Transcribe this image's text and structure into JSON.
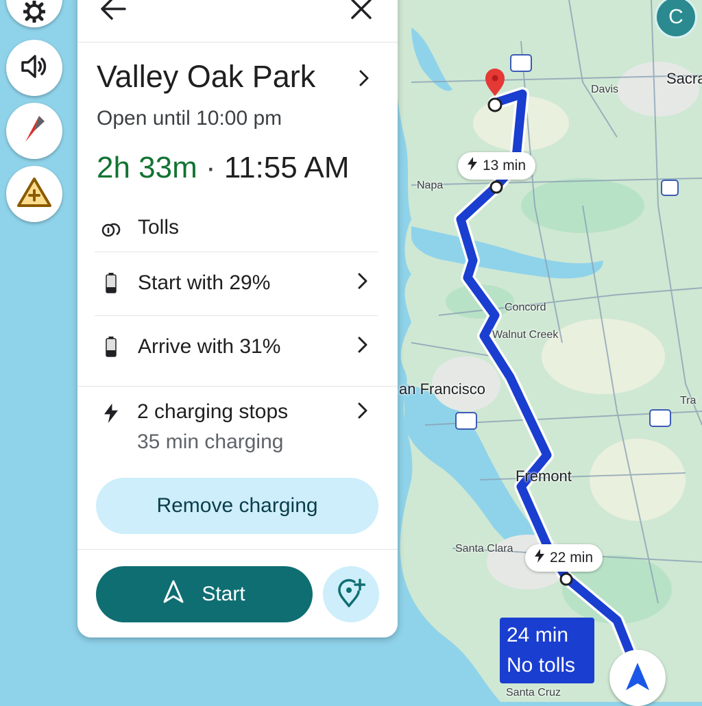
{
  "card": {
    "destination": "Valley Oak Park",
    "hours": "Open until 10:00 pm",
    "duration": "2h 33m",
    "separator": "·",
    "arrival_time": "11:55 AM",
    "rows": {
      "tolls": "Tolls",
      "start_battery": "Start with 29%",
      "arrive_battery": "Arrive with 31%",
      "charging_stops": "2 charging stops",
      "charging_time": "35 min charging"
    },
    "remove_charging_label": "Remove charging",
    "start_label": "Start"
  },
  "map": {
    "avatar_letter": "C",
    "bubbles": {
      "north": "13 min",
      "south": "22 min"
    },
    "route_summary": {
      "time": "24 min",
      "tolls": "No tolls"
    },
    "labels": {
      "sacramento": "Sacra",
      "davis": "Davis",
      "napa": "Napa",
      "concord": "Concord",
      "walnut_creek": "Walnut Creek",
      "san_francisco": "an Francisco",
      "tracy": "Tra",
      "fremont": "Fremont",
      "santa_clara": "Santa Clara",
      "santa_cruz": "Santa Cruz"
    },
    "colors": {
      "route": "#1a3ed0",
      "water": "#8fd3ea",
      "land": "#cfe8d3",
      "accent": "#0f6e72"
    }
  }
}
